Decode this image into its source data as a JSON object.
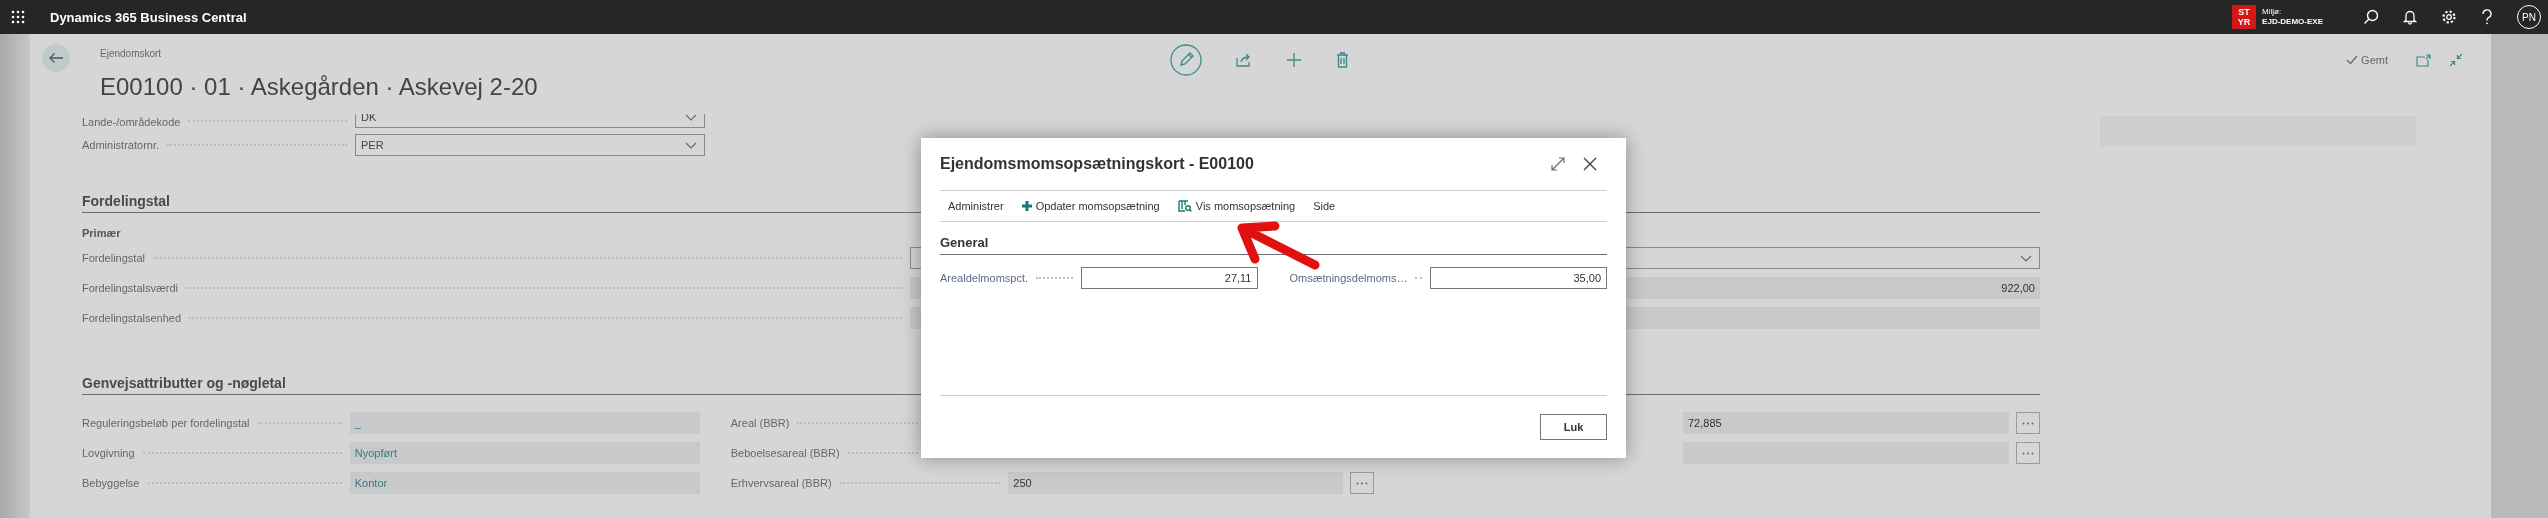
{
  "top_bar": {
    "app_name": "Dynamics 365 Business Central",
    "badge_lines": [
      "ST",
      "YR"
    ],
    "environment_label": "Miljø:",
    "environment_name": "EJD-DEMO-EXE",
    "user_initials": "PN"
  },
  "page": {
    "breadcrumb": "Ejendomskort",
    "title": "E00100 · 01 · Askegården · Askevej 2-20",
    "status": "Gemt"
  },
  "general_rows": [
    {
      "label": "Lande-/områdekode",
      "value": "DK"
    },
    {
      "label": "Administratornr.",
      "value": "PER"
    }
  ],
  "fordelingstal": {
    "heading": "Fordelingstal",
    "subheading": "Primær",
    "rows": [
      {
        "label": "Fordelingstal",
        "kind": "dropdown"
      },
      {
        "label": "Fordelingstalsværdi",
        "kind": "readonly",
        "value": "922,00"
      },
      {
        "label": "Fordelingstalsenhed",
        "kind": "readonly"
      }
    ]
  },
  "genvej": {
    "heading": "Genvejsattributter og -nøgletal",
    "columns": [
      [
        {
          "label": "Reguleringsbeløb per fordelingstal",
          "value": "_",
          "link": true
        },
        {
          "label": "Lovgivning",
          "value": "Nyopført",
          "link": true
        },
        {
          "label": "Bebyggelse",
          "value": "Kontor",
          "link": true
        }
      ],
      [
        {
          "label": "Areal (BBR)"
        },
        {
          "label": "Beboelsesareal (BBR)"
        },
        {
          "label": "Erhvervsareal (BBR)",
          "value": "250",
          "link": false,
          "assist": true
        }
      ],
      [
        {
          "value": "72,885",
          "link": false,
          "assist": true
        },
        {
          "link": false,
          "assist": true
        }
      ]
    ]
  },
  "dialog": {
    "title": "Ejendomsmomsopsætningskort - E00100",
    "actions": [
      {
        "label": "Administrer",
        "kind": "text"
      },
      {
        "label": "Opdater momsopsætning",
        "kind": "add"
      },
      {
        "label": "Vis momsopsætning",
        "kind": "show"
      },
      {
        "label": "Side",
        "kind": "text"
      }
    ],
    "section": "General",
    "fields": [
      {
        "label": "Arealdelmomspct.",
        "value": "27,11"
      },
      {
        "label": "Omsætningsdelmoms…",
        "value": "35,00"
      }
    ],
    "close_button": "Luk"
  }
}
